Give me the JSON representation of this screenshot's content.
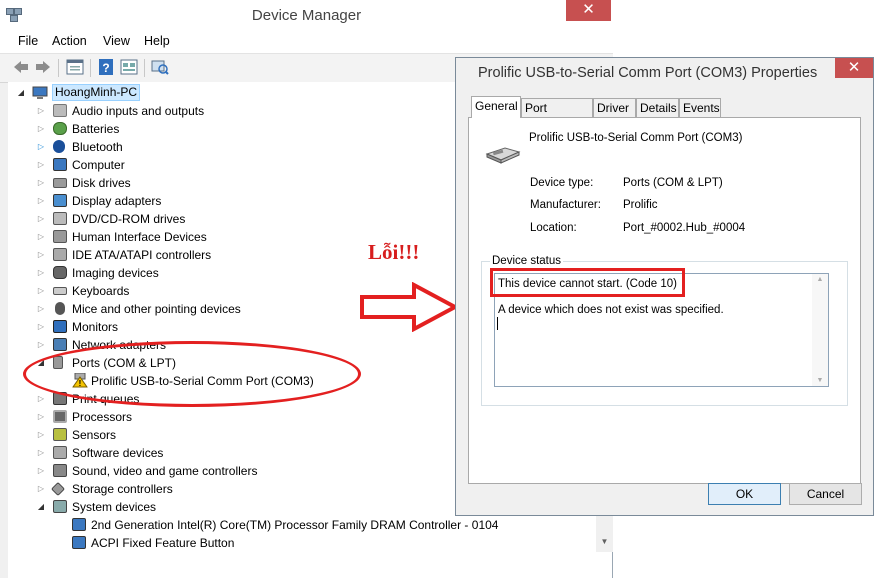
{
  "device_manager": {
    "title": "Device Manager",
    "close_glyph": "✕",
    "menu": [
      "File",
      "Action",
      "View",
      "Help"
    ],
    "toolbar_icons": [
      "back-icon",
      "forward-icon",
      "properties-icon",
      "help-icon",
      "view-icon",
      "scan-hardware-icon"
    ],
    "tree": {
      "root": "HoangMinh-PC",
      "items": [
        {
          "label": "Audio inputs and outputs",
          "icon": "audio-icon",
          "expanded": false
        },
        {
          "label": "Batteries",
          "icon": "battery-icon",
          "expanded": false
        },
        {
          "label": "Bluetooth",
          "icon": "bluetooth-icon",
          "expanded": false
        },
        {
          "label": "Computer",
          "icon": "computer-icon",
          "expanded": false
        },
        {
          "label": "Disk drives",
          "icon": "disk-icon",
          "expanded": false
        },
        {
          "label": "Display adapters",
          "icon": "display-icon",
          "expanded": false
        },
        {
          "label": "DVD/CD-ROM drives",
          "icon": "dvd-icon",
          "expanded": false
        },
        {
          "label": "Human Interface Devices",
          "icon": "hid-icon",
          "expanded": false
        },
        {
          "label": "IDE ATA/ATAPI controllers",
          "icon": "ide-icon",
          "expanded": false
        },
        {
          "label": "Imaging devices",
          "icon": "camera-icon",
          "expanded": false
        },
        {
          "label": "Keyboards",
          "icon": "keyboard-icon",
          "expanded": false
        },
        {
          "label": "Mice and other pointing devices",
          "icon": "mouse-icon",
          "expanded": false
        },
        {
          "label": "Monitors",
          "icon": "monitor-icon",
          "expanded": false
        },
        {
          "label": "Network adapters",
          "icon": "network-icon",
          "expanded": false
        },
        {
          "label": "Ports (COM & LPT)",
          "icon": "port-icon",
          "expanded": true
        },
        {
          "label": "Prolific USB-to-Serial Comm Port (COM3)",
          "icon": "warning-port-icon",
          "child": true
        },
        {
          "label": "Print queues",
          "icon": "printer-icon",
          "expanded": false
        },
        {
          "label": "Processors",
          "icon": "processor-icon",
          "expanded": false
        },
        {
          "label": "Sensors",
          "icon": "sensor-icon",
          "expanded": false
        },
        {
          "label": "Software devices",
          "icon": "software-icon",
          "expanded": false
        },
        {
          "label": "Sound, video and game controllers",
          "icon": "sound-icon",
          "expanded": false
        },
        {
          "label": "Storage controllers",
          "icon": "storage-icon",
          "expanded": false
        },
        {
          "label": "System devices",
          "icon": "system-icon",
          "expanded": true
        },
        {
          "label": "2nd Generation Intel(R) Core(TM) Processor Family DRAM Controller - 0104",
          "icon": "chip-icon",
          "child": true
        },
        {
          "label": "ACPI Fixed Feature Button",
          "icon": "chip-icon",
          "child": true
        }
      ]
    }
  },
  "annotation": {
    "error_text": "Lỗi!!!",
    "color": "#e32020"
  },
  "properties": {
    "title": "Prolific USB-to-Serial Comm Port (COM3) Properties",
    "close_glyph": "✕",
    "tabs": [
      "General",
      "Port Settings",
      "Driver",
      "Details",
      "Events"
    ],
    "active_tab": "General",
    "device_name": "Prolific USB-to-Serial Comm Port (COM3)",
    "fields": [
      {
        "label": "Device type:",
        "value": "Ports (COM & LPT)"
      },
      {
        "label": "Manufacturer:",
        "value": "Prolific"
      },
      {
        "label": "Location:",
        "value": "Port_#0002.Hub_#0004"
      }
    ],
    "status_legend": "Device status",
    "status_line1": "This device cannot start. (Code 10)",
    "status_line2": "A device which does not exist was specified.",
    "ok_label": "OK",
    "cancel_label": "Cancel"
  }
}
